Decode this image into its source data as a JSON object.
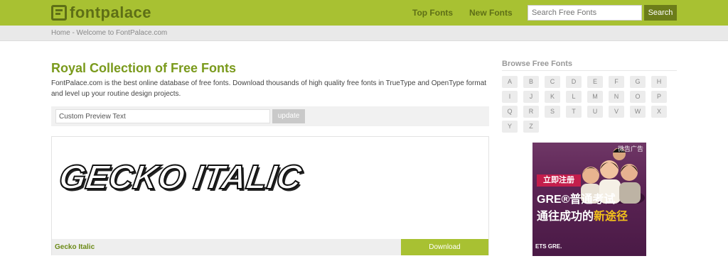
{
  "header": {
    "logo_text": "fontpalace",
    "nav": [
      "Top Fonts",
      "New Fonts"
    ],
    "search_placeholder": "Search Free Fonts",
    "search_button": "Search"
  },
  "breadcrumb": "Home - Welcome to FontPalace.com",
  "main": {
    "title": "Royal Collection of Free Fonts",
    "intro": "FontPalace.com is the best online database of free fonts. Download thousands of high quality free fonts in TrueType and OpenType format and level up your routine design projects.",
    "preview_value": "Custom Preview Text",
    "update_button": "update",
    "font_card": {
      "sample_text": "GECKO ITALIC",
      "font_name": "Gecko Italic",
      "download_button": "Download"
    }
  },
  "sidebar": {
    "browse_title": "Browse Free Fonts",
    "letters": [
      "A",
      "B",
      "C",
      "D",
      "E",
      "F",
      "G",
      "H",
      "I",
      "J",
      "K",
      "L",
      "M",
      "N",
      "O",
      "P",
      "Q",
      "R",
      "S",
      "T",
      "U",
      "V",
      "W",
      "X",
      "Y",
      "Z"
    ]
  },
  "ad": {
    "tag": "微告广告",
    "badge": "立即注册",
    "line1": "GRE®普通考试",
    "line2_pre": "通往成功的",
    "line2_hl": "新途径",
    "logo": "ETS GRE."
  },
  "colors": {
    "brand_green": "#a8c132",
    "dark_green": "#5e6f16",
    "title_green": "#7a9a1c",
    "ad_purple": "#5b2454"
  }
}
